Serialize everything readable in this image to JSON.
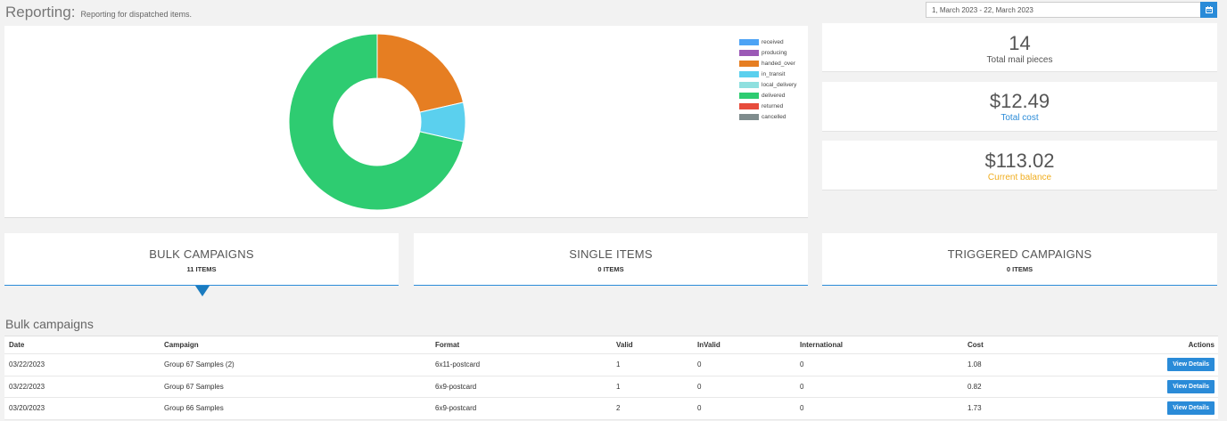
{
  "header": {
    "title": "Reporting:",
    "subtitle": "Reporting for dispatched items."
  },
  "date_range": {
    "value": "1, March 2023 - 22, March 2023",
    "icon": "calendar-icon"
  },
  "chart_data": {
    "type": "pie",
    "donut": true,
    "categories": [
      "received",
      "producing",
      "handed_over",
      "in_transit",
      "local_delivery",
      "delivered",
      "returned",
      "cancelled"
    ],
    "values": [
      0,
      0,
      3,
      1,
      0,
      10,
      0,
      0
    ],
    "colors": [
      "#4da3f5",
      "#9b59b6",
      "#e67e22",
      "#5bd0ee",
      "#8fe0df",
      "#2ecc71",
      "#e74c3c",
      "#7f8c8d"
    ],
    "legend_position": "top-right"
  },
  "stats": [
    {
      "value": "14",
      "label": "Total mail pieces",
      "color": "#555555"
    },
    {
      "value": "$12.49",
      "label": "Total cost",
      "color": "#2a8bd8"
    },
    {
      "value": "$113.02",
      "label": "Current balance",
      "color": "#f0ad1e"
    }
  ],
  "tabs": [
    {
      "title": "BULK CAMPAIGNS",
      "count": "11 ITEMS"
    },
    {
      "title": "SINGLE ITEMS",
      "count": "0 ITEMS"
    },
    {
      "title": "TRIGGERED CAMPAIGNS",
      "count": "0 ITEMS"
    }
  ],
  "section_title": "Bulk campaigns",
  "table": {
    "headers": {
      "date": "Date",
      "campaign": "Campaign",
      "format": "Format",
      "valid": "Valid",
      "invalid": "InValid",
      "international": "International",
      "cost": "Cost",
      "actions": "Actions"
    },
    "rows": [
      {
        "date": "03/22/2023",
        "campaign": "Group 67 Samples (2)",
        "format": "6x11-postcard",
        "valid": "1",
        "invalid": "0",
        "international": "0",
        "cost": "1.08",
        "action": "View Details"
      },
      {
        "date": "03/22/2023",
        "campaign": "Group 67 Samples",
        "format": "6x9-postcard",
        "valid": "1",
        "invalid": "0",
        "international": "0",
        "cost": "0.82",
        "action": "View Details"
      },
      {
        "date": "03/20/2023",
        "campaign": "Group 66 Samples",
        "format": "6x9-postcard",
        "valid": "2",
        "invalid": "0",
        "international": "0",
        "cost": "1.73",
        "action": "View Details"
      }
    ]
  }
}
